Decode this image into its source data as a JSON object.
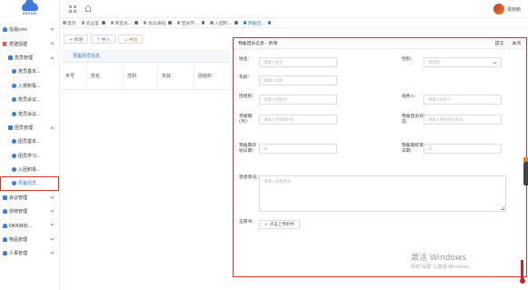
{
  "app": {
    "brand": "SUYUN",
    "user": "梁晓鹏"
  },
  "sidebar": {
    "items": [
      {
        "label": "信易crm",
        "level": 0,
        "icon": "person-icon",
        "chev": "down"
      },
      {
        "label": "党建促建",
        "level": 0,
        "icon": "flag-icon",
        "chev": "up"
      },
      {
        "label": "党员管理",
        "level": 1,
        "icon": "folder-icon",
        "chev": "up"
      },
      {
        "label": "党员基本...",
        "level": 2,
        "icon": "circle-icon"
      },
      {
        "label": "入党积极...",
        "level": 2,
        "icon": "circle-icon"
      },
      {
        "label": "党员会议...",
        "level": 2,
        "icon": "circle-icon"
      },
      {
        "label": "党员会议...",
        "level": 2,
        "icon": "circle-icon"
      },
      {
        "label": "团员管理",
        "level": 1,
        "icon": "folder-icon",
        "chev": "up"
      },
      {
        "label": "团员基本...",
        "level": 2,
        "icon": "circle-icon"
      },
      {
        "label": "团员学习...",
        "level": 2,
        "icon": "circle-icon"
      },
      {
        "label": "入团积极...",
        "level": 2,
        "icon": "circle-icon"
      },
      {
        "label": "预备团员...",
        "level": 2,
        "icon": "circle-icon",
        "active": true
      },
      {
        "label": "会议管理",
        "level": 0,
        "icon": "folder-icon",
        "chev": "down"
      },
      {
        "label": "快特管理",
        "level": 0,
        "icon": "person-icon",
        "chev": "down"
      },
      {
        "label": "OKR目标...",
        "level": 0,
        "icon": "person-icon",
        "chev": "down"
      },
      {
        "label": "物品管理",
        "level": 0,
        "icon": "person-icon",
        "chev": "down"
      },
      {
        "label": "人事管理",
        "level": 0,
        "icon": "person-icon",
        "chev": "down"
      }
    ]
  },
  "tabs": [
    {
      "label": "首页",
      "close": false
    },
    {
      "label": "会议室",
      "close": true
    },
    {
      "label": "荣定会...",
      "close": true
    },
    {
      "label": "会议通知",
      "close": true
    },
    {
      "label": "团员学...",
      "close": true
    },
    {
      "label": "入团积...",
      "close": true
    },
    {
      "label": "预备团...",
      "close": true,
      "active": true
    }
  ],
  "toolbar": {
    "add": "+ 新增",
    "import": "⇡ 导入",
    "export": "⇣ 导出"
  },
  "table": {
    "section": "预备团员信息",
    "headers": [
      "序号",
      "姓名",
      "性别",
      "年龄",
      "团组织"
    ]
  },
  "panel": {
    "title": "预备团员信息 - 新增",
    "submit": "提交",
    "close": "关闭"
  },
  "form": {
    "name": {
      "label": "姓名:",
      "placeholder": "请输入姓名"
    },
    "gender": {
      "label": "性别:",
      "placeholder": "请选择"
    },
    "age": {
      "label": "年龄:",
      "placeholder": "请输入年龄"
    },
    "org": {
      "label": "团组织:",
      "placeholder": "请输入团组织"
    },
    "introducer": {
      "label": "培养人:",
      "placeholder": "请输入培养人"
    },
    "exam": {
      "label": "考察期(月):",
      "placeholder": "请输入考察期(月)"
    },
    "status": {
      "label": "预备团员状态:",
      "placeholder": "请输入预备团员状态"
    },
    "start": {
      "label": "预备期开始日期:",
      "placeholder": "日"
    },
    "end": {
      "label": "预备期结束日期:",
      "placeholder": "日"
    },
    "study": {
      "label": "思想情况:",
      "placeholder": "请输入思想情况"
    },
    "application": {
      "label": "志愿书:",
      "button": "点击上传附件"
    }
  },
  "watermark": {
    "line1": "激活 Windows",
    "line2": "转到\"设置\"以激活 Windows。"
  }
}
